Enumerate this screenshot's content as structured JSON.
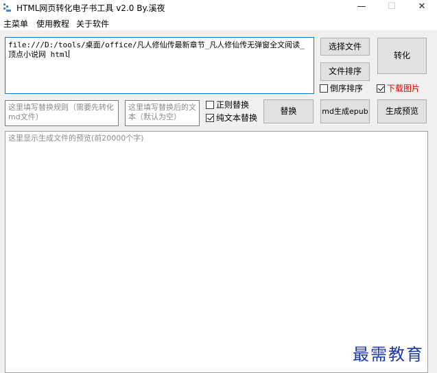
{
  "window": {
    "title": "HTML网页转化电子书工具 v2.0 By.溪夜",
    "minimize": "—",
    "maximize": "☐",
    "close": "✕"
  },
  "menu": [
    "主菜单",
    "使用教程",
    "关于软件"
  ],
  "url_input": {
    "value": "file:///D:/tools/桌面/office/凡人修仙传最新章节_凡人修仙传无弹窗全文阅读_顶点小说网 html"
  },
  "buttons": {
    "select_file": "选择文件",
    "sort_files": "文件排序",
    "convert": "转化",
    "replace": "替换",
    "md_to_epub": "md生成epub",
    "generate_preview": "生成预览"
  },
  "checkboxes": {
    "reverse_sort": {
      "label": "倒序排序",
      "checked": false
    },
    "download_images": {
      "label": "下载图片",
      "checked": true,
      "color": "#e00000"
    },
    "regex_replace": {
      "label": "正则替换",
      "checked": false
    },
    "plain_text_replace": {
      "label": "纯文本替换",
      "checked": true
    }
  },
  "rule_input": {
    "placeholder": "这里填写替换规则（需要先转化md文件）"
  },
  "replacement_input": {
    "placeholder": "这里填写替换后的文本（默认为空）"
  },
  "preview": {
    "placeholder": "这里显示生成文件的预览(前20000个字)"
  },
  "watermark": "最需教育",
  "colors": {
    "accent": "#0078d7",
    "watermark": "#1d36a8"
  }
}
